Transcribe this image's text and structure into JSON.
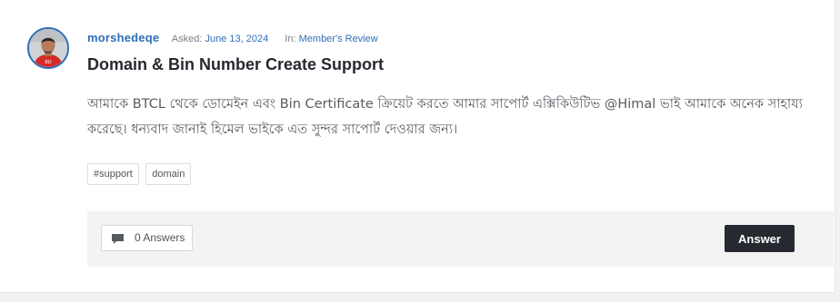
{
  "question": {
    "author": "morshedeqe",
    "asked_label": "Asked:",
    "asked_date": "June 13, 2024",
    "in_label": "In:",
    "category": "Member's Review",
    "title": "Domain & Bin Number Create Support",
    "body": "আমাকে BTCL থেকে ডোমেইন এবং Bin Certificate ক্রিয়েট করতে আমার সাপোর্ট এক্সিকিউটিভ @Himal ভাই আমাকে অনেক সাহায্য করেছে। ধন্যবাদ জানাই হিমেল ভাইকে এত সুন্দর সাপোর্ট দেওয়ার জন্য।",
    "tags": [
      "#support",
      "domain"
    ]
  },
  "footer": {
    "answers_icon": "comment-icon",
    "answers_label": "0 Answers",
    "answer_button": "Answer"
  },
  "colors": {
    "accent": "#2f6fb8",
    "title": "#26292f",
    "button_bg": "#26292f",
    "footer_bg": "#f3f3f3"
  }
}
